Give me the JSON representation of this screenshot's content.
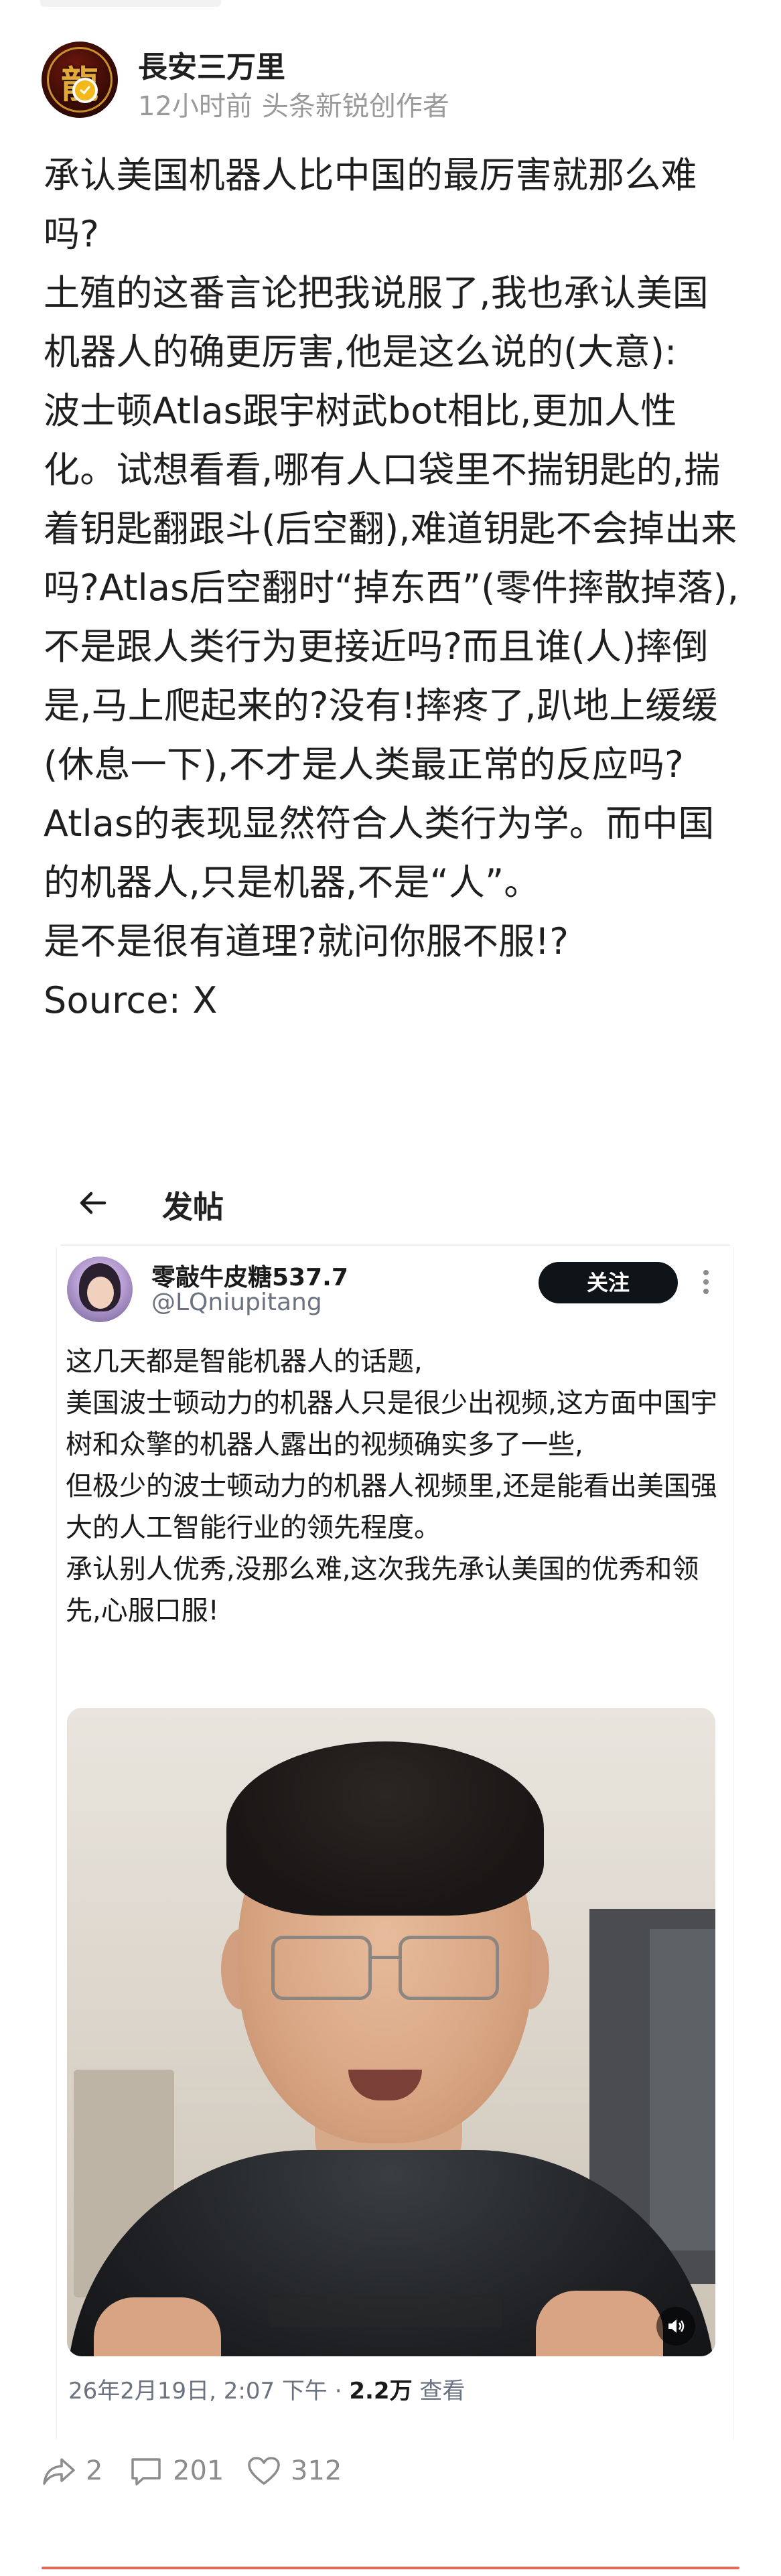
{
  "author": {
    "name": "長安三万里",
    "time": "12小时前",
    "tag": "头条新锐创作者",
    "avatar_glyph": "龍"
  },
  "post": {
    "paragraphs": [
      "承认美国机器人比中国的最厉害就那么难吗?",
      "土殖的这番言论把我说服了,我也承认美国机器人的确更厉害,他是这么说的(大意):",
      "波士顿Atlas跟宇树武bot相比,更加人性化。试想看看,哪有人口袋里不揣钥匙的,揣着钥匙翻跟斗(后空翻),难道钥匙不会掉出来吗?Atlas后空翻时“掉东西”(零件摔散掉落),不是跟人类行为更接近吗?而且谁(人)摔倒是,马上爬起来的?没有!摔疼了,趴地上缓缓(休息一下),不才是人类最正常的反应吗?Atlas的表现显然符合人类行为学。而中国的机器人,只是机器,不是“人”。",
      "是不是很有道理?就问你服不服!?",
      "Source: X"
    ]
  },
  "embed": {
    "title": "发帖",
    "tweet": {
      "display_name": "零敲牛皮糖537.7",
      "handle": "@LQniupitang",
      "follow_label": "关注",
      "lines": [
        "这几天都是智能机器人的话题,",
        "美国波士顿动力的机器人只是很少出视频,这方面中国宇树和众擎的机器人露出的视频确实多了一些,",
        "但极少的波士顿动力的机器人视频里,还是能看出美国强大的人工智能行业的领先程度。",
        "承认别人优秀,没那么难,这次我先承认美国的优秀和领先,心服口服!"
      ],
      "timestamp": "26年2月19日, 2:07 下午 · ",
      "views_count": "2.2万",
      "views_label": " 查看"
    }
  },
  "actions": {
    "share_count": "2",
    "comment_count": "201",
    "like_count": "312"
  },
  "colors": {
    "follow_button_bg": "#0f1419",
    "verify_badge": "#f3b81a",
    "bottom_rule": "#e06a5a"
  }
}
